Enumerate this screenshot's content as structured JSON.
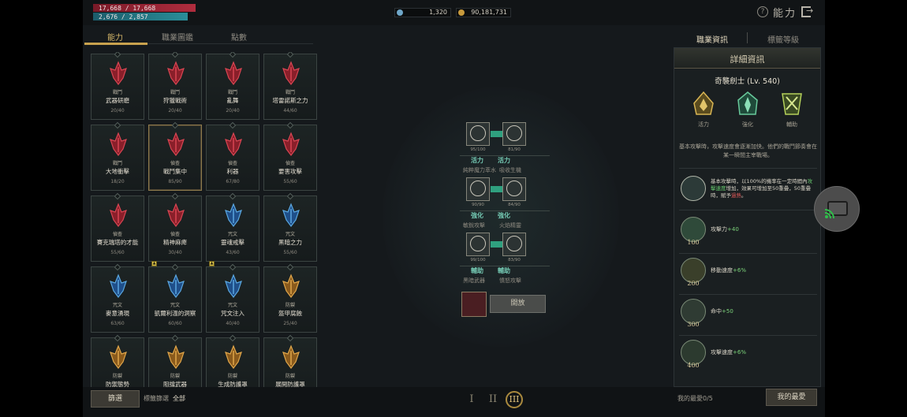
{
  "status": {
    "hp": "17,668 / 17,668",
    "mp": "2,676 / 2,857",
    "currency1": "1,320",
    "currency2": "90,181,731"
  },
  "header": {
    "title": "能力",
    "help_icon": "help-circle-icon",
    "exit_icon": "exit-icon"
  },
  "tabs": [
    "能力",
    "職業圖鑑",
    "點數"
  ],
  "skills": [
    {
      "category": "戰鬥",
      "name": "武器研磨",
      "level": "20/40",
      "color": "red"
    },
    {
      "category": "戰鬥",
      "name": "狩獵戰術",
      "level": "20/40",
      "color": "red"
    },
    {
      "category": "戰鬥",
      "name": "亂舞",
      "level": "20/40",
      "color": "red"
    },
    {
      "category": "戰鬥",
      "name": "塔雷諾斯之力",
      "level": "44/60",
      "color": "red"
    },
    {
      "category": "戰鬥",
      "name": "大地衝擊",
      "level": "18/20",
      "color": "red"
    },
    {
      "category": "偵查",
      "name": "戰鬥集中",
      "level": "85/90",
      "color": "red",
      "selected": true
    },
    {
      "category": "偵查",
      "name": "利器",
      "level": "67/80",
      "color": "red"
    },
    {
      "category": "偵查",
      "name": "要害攻擊",
      "level": "55/60",
      "color": "red"
    },
    {
      "category": "偵查",
      "name": "賽克瑞塔的才能",
      "level": "55/60",
      "color": "red"
    },
    {
      "category": "偵查",
      "name": "精神麻痺",
      "level": "30/40",
      "color": "red"
    },
    {
      "category": "咒文",
      "name": "靈魂戒擊",
      "level": "43/60",
      "color": "blue"
    },
    {
      "category": "咒文",
      "name": "黑暗之力",
      "level": "55/60",
      "color": "blue"
    },
    {
      "category": "咒文",
      "name": "麥意湧現",
      "level": "63/60",
      "color": "blue"
    },
    {
      "category": "咒文",
      "name": "凱爾利溫的洞察",
      "level": "60/60",
      "color": "blue",
      "badge": true
    },
    {
      "category": "咒文",
      "name": "咒文注入",
      "level": "40/40",
      "color": "blue",
      "badge": true
    },
    {
      "category": "防禦",
      "name": "盔甲腐蝕",
      "level": "25/40",
      "color": "gold"
    },
    {
      "category": "防禦",
      "name": "防禦態勢",
      "level": "",
      "color": "gold"
    },
    {
      "category": "防禦",
      "name": "阻擋武器",
      "level": "",
      "color": "gold"
    },
    {
      "category": "防禦",
      "name": "生成防護罩",
      "level": "",
      "color": "gold"
    },
    {
      "category": "防禦",
      "name": "展開防護罩",
      "level": "",
      "color": "gold"
    }
  ],
  "tree": {
    "rows": [
      {
        "types": [
          "活力",
          "活力"
        ],
        "skills": [
          "純粹魔力萃水",
          "吸收生機"
        ],
        "values": [
          "95/100",
          "81/90"
        ]
      },
      {
        "types": [
          "強化",
          "強化"
        ],
        "skills": [
          "敏銳攻擊",
          "火焰精靈"
        ],
        "values": [
          "90/90",
          "84/90"
        ]
      },
      {
        "types": [
          "輔助",
          "輔助"
        ],
        "skills": [
          "黑暗武器",
          "憤怒攻擊"
        ],
        "values": [
          "99/100",
          "83/90"
        ]
      }
    ],
    "open_label": "開放"
  },
  "filter": {
    "button": "篩選",
    "label": "標籤篩選",
    "value": "全部"
  },
  "pages": [
    "I",
    "II",
    "III"
  ],
  "favorites": {
    "label": "我的最愛0/5",
    "button": "我的最愛"
  },
  "right": {
    "tabs": [
      "職業資訊",
      "標籤等級"
    ],
    "title": "詳細資訊",
    "class_name": "奇襲劍士 (Lv. 540)",
    "icons": [
      "活力",
      "強化",
      "輔助"
    ],
    "description": "基本攻擊時，攻擊速度會逐漸加快。他們的戰鬥節奏會在某一瞬間主宰戰場。",
    "condition": {
      "pre": "基本攻擊時，以100%的機率在一定時間內",
      "green": "攻擊速度",
      "mid": "增加，效果可增加至50重疊，50重疊時，賦予",
      "red": "過熱",
      "post": "。"
    },
    "bonuses": [
      {
        "level": "100",
        "text": "攻擊力",
        "plus": "+40"
      },
      {
        "level": "200",
        "text": "移動速度",
        "plus": "+6%"
      },
      {
        "level": "300",
        "text": "命中",
        "plus": "+50"
      },
      {
        "level": "400",
        "text": "攻擊速度",
        "plus": "+6%"
      }
    ]
  },
  "colors": {
    "accent_gold": "#c9a24e",
    "hp": "#b02d3e",
    "mp": "#2a8e99",
    "tree_link": "#2fa07f"
  }
}
